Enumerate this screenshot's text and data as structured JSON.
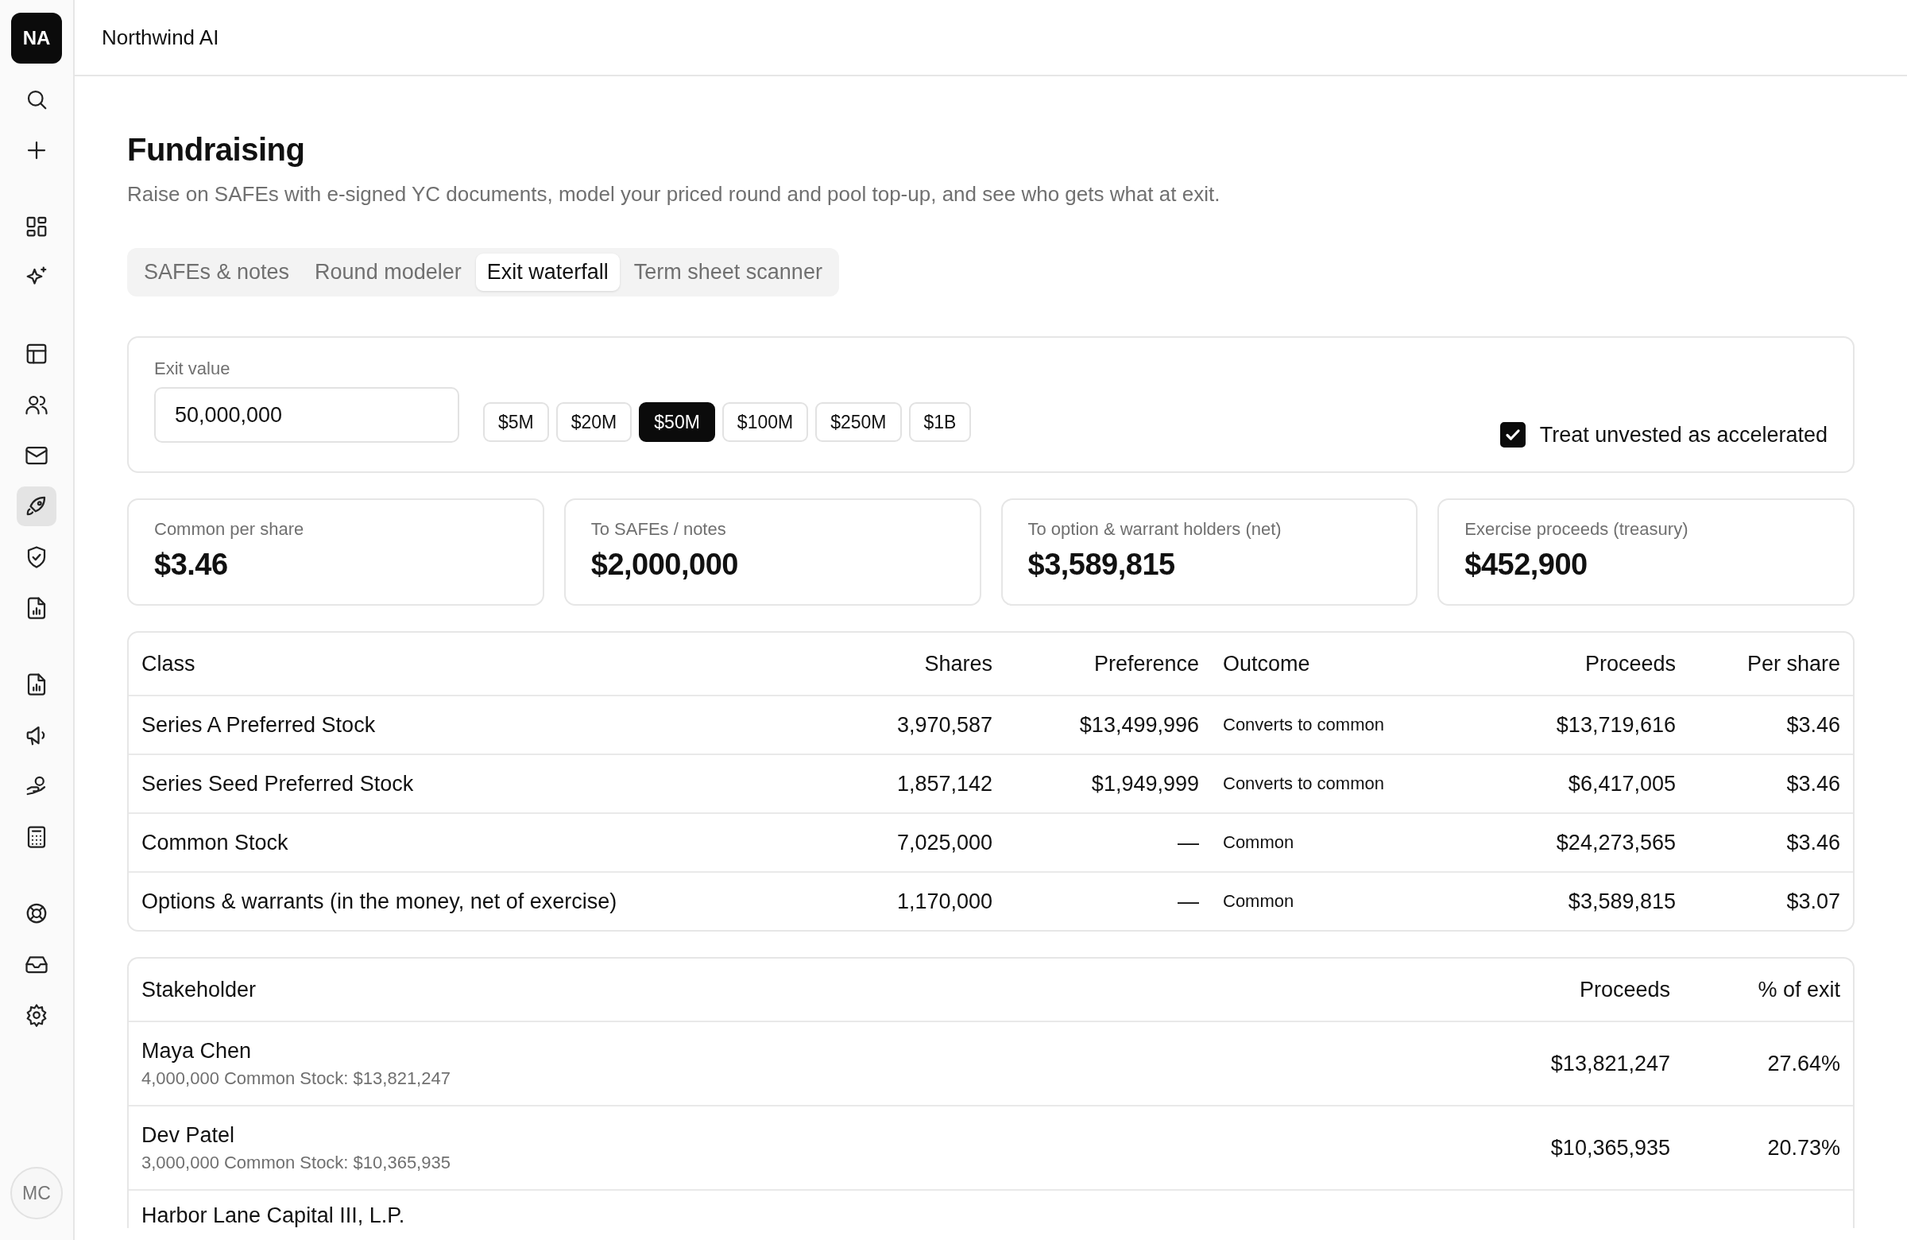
{
  "sidebar": {
    "logo": "NA",
    "groups": [
      [
        {
          "selected": false
        },
        {
          "selected": false
        }
      ],
      [
        {
          "selected": false
        },
        {
          "selected": false
        }
      ],
      [
        {
          "selected": false
        },
        {
          "selected": false
        },
        {
          "selected": false
        },
        {
          "selected": true
        },
        {
          "selected": false
        },
        {
          "selected": false
        }
      ],
      [
        {
          "selected": false
        },
        {
          "selected": false
        },
        {
          "selected": false
        },
        {
          "selected": false
        }
      ],
      [
        {
          "selected": false
        },
        {
          "selected": false
        },
        {
          "selected": false
        }
      ]
    ],
    "user": "MC"
  },
  "header": {
    "workspace": "Northwind AI"
  },
  "page": {
    "title": "Fundraising",
    "subtitle": "Raise on SAFEs with e-signed YC documents, model your priced round and pool top-up, and see who gets what at exit."
  },
  "tabs": [
    {
      "label": "SAFEs & notes",
      "selected": false
    },
    {
      "label": "Round modeler",
      "selected": false
    },
    {
      "label": "Exit waterfall",
      "selected": true
    },
    {
      "label": "Term sheet scanner",
      "selected": false
    }
  ],
  "controls": {
    "exit_label": "Exit value",
    "exit_value": "50,000,000",
    "presets": [
      {
        "label": "$5M",
        "selected": false
      },
      {
        "label": "$20M",
        "selected": false
      },
      {
        "label": "$50M",
        "selected": true
      },
      {
        "label": "$100M",
        "selected": false
      },
      {
        "label": "$250M",
        "selected": false
      },
      {
        "label": "$1B",
        "selected": false
      }
    ],
    "accelerated": {
      "label": "Treat unvested as accelerated",
      "checked": true
    }
  },
  "stats": [
    {
      "label": "Common per share",
      "value": "$3.46"
    },
    {
      "label": "To SAFEs / notes",
      "value": "$2,000,000"
    },
    {
      "label": "To option & warrant holders (net)",
      "value": "$3,589,815"
    },
    {
      "label": "Exercise proceeds (treasury)",
      "value": "$452,900"
    }
  ],
  "class_table": {
    "columns": [
      "Class",
      "Shares",
      "Preference",
      "Outcome",
      "Proceeds",
      "Per share"
    ],
    "rows": [
      [
        "Series A Preferred Stock",
        "3,970,587",
        "$13,499,996",
        "Converts to common",
        "$13,719,616",
        "$3.46"
      ],
      [
        "Series Seed Preferred Stock",
        "1,857,142",
        "$1,949,999",
        "Converts to common",
        "$6,417,005",
        "$3.46"
      ],
      [
        "Common Stock",
        "7,025,000",
        "—",
        "Common",
        "$24,273,565",
        "$3.46"
      ],
      [
        "Options & warrants (in the money, net of exercise)",
        "1,170,000",
        "—",
        "Common",
        "$3,589,815",
        "$3.07"
      ]
    ]
  },
  "stakeholder_table": {
    "columns": [
      "Stakeholder",
      "Proceeds",
      "% of exit"
    ],
    "rows": [
      {
        "name": "Maya Chen",
        "detail": "4,000,000 Common Stock: $13,821,247",
        "proceeds": "$13,821,247",
        "percent": "27.64%"
      },
      {
        "name": "Dev Patel",
        "detail": "3,000,000 Common Stock: $10,365,935",
        "proceeds": "$10,365,935",
        "percent": "20.73%"
      },
      {
        "name": "Harbor Lane Capital III, L.P."
      }
    ]
  }
}
